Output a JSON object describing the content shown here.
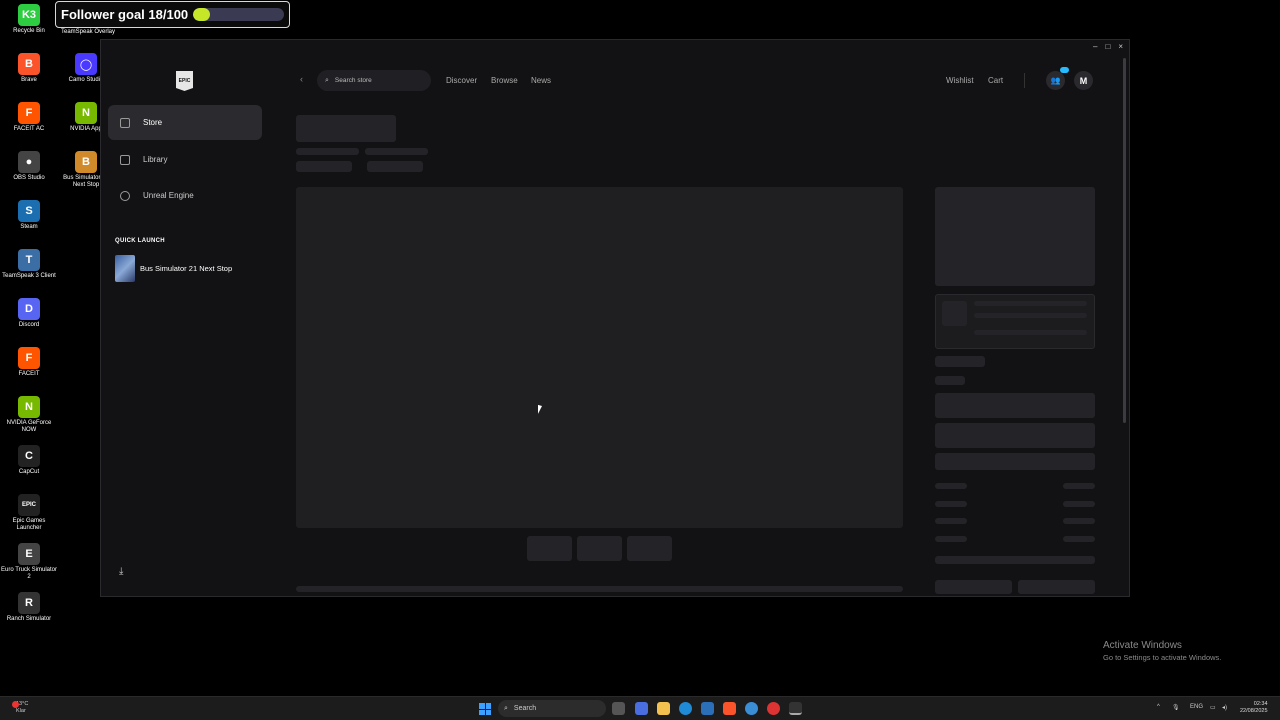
{
  "desktop": {
    "icons": [
      {
        "label": "Recycle Bin",
        "glyph": "K3",
        "color": "#2ecc40"
      },
      {
        "label": "Brave",
        "glyph": "B",
        "color": "#fb542b"
      },
      {
        "label": "FACEIT AC",
        "glyph": "F",
        "color": "#ff5500"
      },
      {
        "label": "OBS Studio",
        "glyph": "●",
        "color": "#444444"
      },
      {
        "label": "Steam",
        "glyph": "S",
        "color": "#1b6fb0"
      },
      {
        "label": "TeamSpeak 3 Client",
        "glyph": "T",
        "color": "#3a6ea5"
      },
      {
        "label": "Discord",
        "glyph": "D",
        "color": "#5865f2"
      },
      {
        "label": "FACEIT",
        "glyph": "F",
        "color": "#ff5500"
      },
      {
        "label": "NVIDIA GeForce NOW",
        "glyph": "N",
        "color": "#76b900"
      },
      {
        "label": "CapCut",
        "glyph": "C",
        "color": "#222222"
      },
      {
        "label": "Epic Games Launcher",
        "glyph": "EPIC",
        "color": "#222222"
      },
      {
        "label": "Euro Truck Simulator 2",
        "glyph": "E",
        "color": "#444444"
      },
      {
        "label": "Ranch Simulator",
        "glyph": "R",
        "color": "#333333"
      }
    ],
    "icons_col2": [
      {
        "label": "Camo Studio",
        "glyph": "◯",
        "color": "#4a3aff"
      },
      {
        "label": "NVIDIA App",
        "glyph": "N",
        "color": "#76b900"
      },
      {
        "label": "Bus Simulator 21 Next Stop",
        "glyph": "B",
        "color": "#d08a2a"
      }
    ],
    "teamspeak_overlay_label": "TeamSpeak Overlay"
  },
  "follower_goal": {
    "text": "Follower goal 18/100",
    "progress": 0.18,
    "fill_color": "#c6e628"
  },
  "launcher": {
    "window_controls": {
      "minimize": "–",
      "maximize": "□",
      "close": "×"
    },
    "logo_text": "EPIC",
    "nav": [
      {
        "label": "Store",
        "icon": "tag-icon",
        "active": true
      },
      {
        "label": "Library",
        "icon": "library-icon",
        "active": false
      },
      {
        "label": "Unreal Engine",
        "icon": "unreal-icon",
        "active": false
      }
    ],
    "quick_launch_title": "QUICK LAUNCH",
    "quick_launch_items": [
      {
        "label": "Bus Simulator 21 Next Stop"
      }
    ],
    "download_icon": "⤓",
    "topbar": {
      "back_glyph": "‹",
      "search_placeholder": "Search store",
      "links": [
        "Discover",
        "Browse",
        "News"
      ],
      "wishlist": "Wishlist",
      "cart": "Cart",
      "avatar_letter": "M",
      "accent": "#26bbff"
    }
  },
  "activate_windows": {
    "title": "Activate Windows",
    "subtitle": "Go to Settings to activate Windows."
  },
  "taskbar": {
    "weather_temp": "13°C",
    "weather_desc": "Klar",
    "search_placeholder": "Search",
    "tray_lang": "ENG",
    "time": "02:34",
    "date": "22/08/2025"
  }
}
